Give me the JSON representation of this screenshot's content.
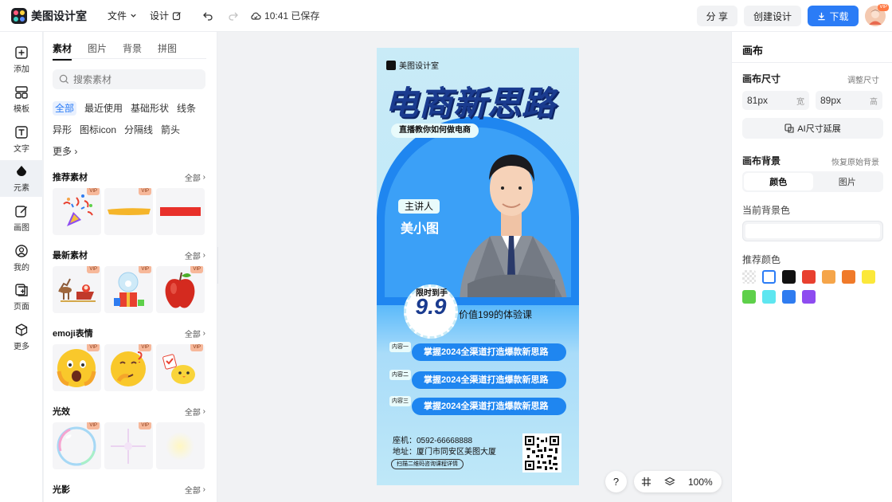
{
  "header": {
    "app_name": "美图设计室",
    "menu_file": "文件",
    "menu_design": "设计",
    "save_status": "10:41 已保存",
    "share": "分 享",
    "create": "创建设计",
    "download": "下载",
    "avatar_badge": "VIP"
  },
  "rail": [
    {
      "label": "添加",
      "icon": "plus-square-icon"
    },
    {
      "label": "模板",
      "icon": "template-grid-icon"
    },
    {
      "label": "文字",
      "icon": "text-t-icon"
    },
    {
      "label": "元素",
      "icon": "shapes-icon"
    },
    {
      "label": "画图",
      "icon": "pencil-square-icon"
    },
    {
      "label": "我的",
      "icon": "user-icon"
    },
    {
      "label": "页面",
      "icon": "page-add-icon"
    },
    {
      "label": "更多",
      "icon": "cube-icon"
    }
  ],
  "material": {
    "tabs": [
      "素材",
      "图片",
      "背景",
      "拼图"
    ],
    "search_placeholder": "搜索素材",
    "filters": [
      [
        "全部",
        "最近使用",
        "基础形状",
        "线条"
      ],
      [
        "异形",
        "图标icon",
        "分隔线",
        "箭头"
      ],
      [
        "更多"
      ]
    ],
    "sections": [
      {
        "title": "推荐素材",
        "all": "全部",
        "items": [
          "party-popper",
          "yellow-brush-stroke",
          "red-bar"
        ]
      },
      {
        "title": "最新素材",
        "all": "全部",
        "items": [
          "santa-sleigh",
          "snow-globe",
          "red-apple"
        ]
      },
      {
        "title": "emoji表情",
        "all": "全部",
        "items": [
          "scared-face",
          "thinking-face",
          "chick-with-note"
        ]
      },
      {
        "title": "光效",
        "all": "全部",
        "items": [
          "rainbow-bubble",
          "sparkle",
          "glow"
        ]
      },
      {
        "title": "光影",
        "all": "全部",
        "items": []
      }
    ],
    "vip_label": "VIP"
  },
  "poster": {
    "brand": "美图设计室",
    "title": "电商新思路",
    "subtitle": "直播教你如何做电商",
    "speaker_tag": "主讲人",
    "speaker_name": "美小图",
    "limited": "限时到手",
    "price": "9.9",
    "price_text": "价值199的体验课",
    "contents": [
      {
        "label": "内容一",
        "text": "掌握2024全渠道打造爆款新思路"
      },
      {
        "label": "内容二",
        "text": "掌握2024全渠道打造爆款新思路"
      },
      {
        "label": "内容三",
        "text": "掌握2024全渠道打造爆款新思路"
      }
    ],
    "phone": "座机：0592-66668888",
    "address": "地址：厦门市同安区美图大厦",
    "hint": "扫描二维码咨询课程详情"
  },
  "toolbar": {
    "help": "?",
    "zoom": "100%"
  },
  "right": {
    "title": "画布",
    "size_label": "画布尺寸",
    "size_adjust": "调整尺寸",
    "width_value": "81px",
    "width_unit": "宽",
    "height_value": "89px",
    "height_unit": "高",
    "ai_extend": "AI尺寸延展",
    "bg_label": "画布背景",
    "bg_restore": "恢复原始背景",
    "seg_color": "颜色",
    "seg_image": "图片",
    "current_bg": "当前背景色",
    "recommend": "推荐颜色",
    "swatches": [
      "transparent",
      "#ffffff",
      "#111111",
      "#e8402f",
      "#f5a54a",
      "#f07a2a",
      "#fbe83a",
      "#5ed04a",
      "#5ee6f0",
      "#2f7cf0",
      "#8e4cf0"
    ]
  },
  "colors": {
    "accent": "#2b7cf6",
    "poster_blue": "#1f86f0",
    "title_navy": "#1a3b8f"
  }
}
